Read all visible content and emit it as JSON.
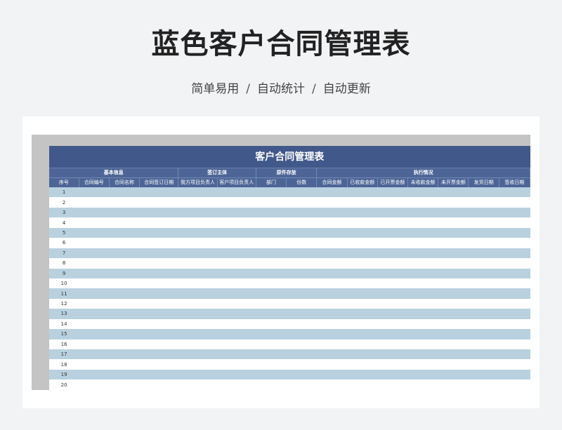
{
  "header": {
    "title": "蓝色客户合同管理表",
    "subtitle": [
      "简单易用",
      "自动统计",
      "自动更新"
    ],
    "separator": "/"
  },
  "sheet": {
    "title": "客户合同管理表",
    "groups": [
      {
        "label": "基本信息",
        "span": 4
      },
      {
        "label": "签订主体",
        "span": 2
      },
      {
        "label": "原件存放",
        "span": 2
      },
      {
        "label": "执行情况",
        "span": 7
      }
    ],
    "columns": [
      "序号",
      "合同编号",
      "合同名称",
      "合同签订日期",
      "我方项目负责人",
      "客户项目负责人",
      "部门",
      "份数",
      "合同金额",
      "已收款金额",
      "已开票金额",
      "未收款金额",
      "未开票金额",
      "发货日期",
      "签收日期"
    ],
    "rows": [
      "1",
      "2",
      "3",
      "4",
      "5",
      "6",
      "7",
      "8",
      "9",
      "10",
      "11",
      "12",
      "13",
      "14",
      "15",
      "16",
      "17",
      "18",
      "19",
      "20"
    ],
    "colors": {
      "title_bg": "#41588a",
      "header_bg": "#4d6596",
      "stripe": "#b9d1df"
    }
  }
}
